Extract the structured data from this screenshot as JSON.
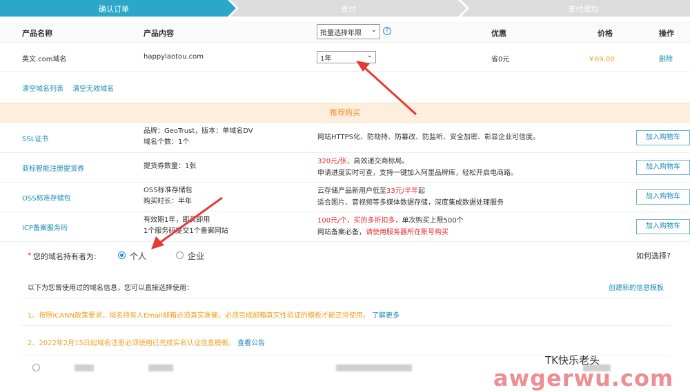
{
  "steps": [
    "确认订单",
    "支付",
    "支付成功"
  ],
  "header": {
    "col_name": "产品名称",
    "col_content": "产品内容",
    "bulk_select": "批量选择年限",
    "col_discount": "优惠",
    "col_price": "价格",
    "col_action": "操作"
  },
  "order": {
    "name": "英文.com域名",
    "content": "happylaotou.com",
    "years": "1年",
    "discount": "省0元",
    "price": "￥69.00",
    "delete": "删除"
  },
  "clear_links": {
    "clear_list": "清空域名列表",
    "clear_invalid": "清空无效域名"
  },
  "recommend_title": "推荐购买",
  "products": [
    {
      "name": "SSL证书",
      "spec1": "品牌：GeoTrust，版本：单域名DV",
      "spec2": "域名个数：1个",
      "desc1": "网站HTTPS化、防劫持、防篡改、防监听、安全加密、彰显企业可信度。",
      "desc1_red": "",
      "desc2": "",
      "desc2_red": "",
      "button": "加入购物车"
    },
    {
      "name": "商标智能注册提货券",
      "spec1": "提货券数量：1张",
      "spec2": "",
      "desc1_red": "320元/张，",
      "desc1": "高效递交商标局。",
      "desc2": "申请进度实时可查，支持一键加入阿里品牌库，轻松开启电商路。",
      "desc2_red": "",
      "button": "加入购物车"
    },
    {
      "name": "OSS标准存储包",
      "spec1": "OSS标准存储包",
      "spec2": "购买时长：半年",
      "desc1": "云存储产品新用户低至",
      "desc1_red": "33元/半年",
      "desc1_tail": "起",
      "desc2": "适合图片、音视频等多媒体数据存储，深度集成数据处理服务",
      "desc2_red": "",
      "button": "加入购物车"
    },
    {
      "name": "ICP备案服务码",
      "spec1": "有效期1年，即买即用",
      "spec2": "1个服务码提交1个备案网站",
      "desc1_red": "100元/个，买的多折扣多，",
      "desc1": "单次购买上限500个",
      "desc2": "网站备案必备，",
      "desc2_red": "请使用服务器所在账号购买",
      "button": "加入购物车"
    }
  ],
  "owner": {
    "label_star": "*",
    "label": "您的域名持有者为:",
    "opt_personal": "个人",
    "opt_company": "企业",
    "how_choose": "如何选择?"
  },
  "info": {
    "used_before": "以下为您曾使用过的域名信息，您可以直接选择使用：",
    "create_template": "创建新的信息模板",
    "notice1": "1、按照ICANN政策要求，域名持有人Email邮箱必须真实准确，必须完成邮箱真实性验证的模板才能正常使用。",
    "notice1_link": "了解更多",
    "notice2": "2、2022年2月15日起域名注册必须使用已完成实名认证信息模板。",
    "notice2_link": "查看公告"
  },
  "watermark": {
    "top": "TK快乐老头",
    "bottom": "awgerwu.com"
  },
  "colors": {
    "accent": "#1a8ab6",
    "step_active": "#2aa7c9",
    "orange": "#f0a020",
    "red": "#e63030"
  }
}
